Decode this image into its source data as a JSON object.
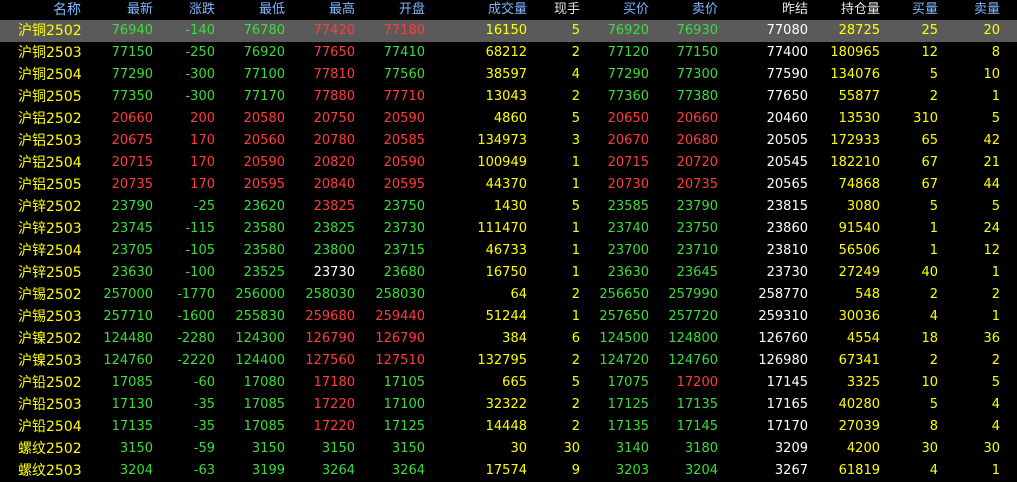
{
  "colors": {
    "up": "#ff3c3c",
    "down": "#3cdc3c",
    "flat": "#ffffff",
    "yellow": "#ffff00",
    "header_blue": "#7fb8ff",
    "selected_bg": "#5a5a5a"
  },
  "headers": {
    "name": "名称",
    "last": "最新",
    "change": "涨跌",
    "low": "最低",
    "high": "最高",
    "open": "开盘",
    "volume": "成交量",
    "current_vol": "现手",
    "bid": "买价",
    "ask": "卖价",
    "prev_settle": "昨结",
    "open_interest": "持仓量",
    "bid_vol": "买量",
    "ask_vol": "卖量"
  },
  "rows": [
    {
      "name": "沪铜2502",
      "last": "76940",
      "change": "-140",
      "low": "76780",
      "high": "77420",
      "open": "77180",
      "volume": "16150",
      "current_vol": "5",
      "bid": "76920",
      "ask": "76930",
      "prev_settle": "77080",
      "open_interest": "28725",
      "bid_vol": "25",
      "ask_vol": "20",
      "c": {
        "last": "down",
        "change": "down",
        "low": "down",
        "high": "up",
        "open": "up",
        "bid": "down",
        "ask": "down"
      }
    },
    {
      "name": "沪铜2503",
      "last": "77150",
      "change": "-250",
      "low": "76920",
      "high": "77650",
      "open": "77410",
      "volume": "68212",
      "current_vol": "2",
      "bid": "77120",
      "ask": "77150",
      "prev_settle": "77400",
      "open_interest": "180965",
      "bid_vol": "12",
      "ask_vol": "8",
      "c": {
        "last": "down",
        "change": "down",
        "low": "down",
        "high": "up",
        "open": "down",
        "bid": "down",
        "ask": "down"
      }
    },
    {
      "name": "沪铜2504",
      "last": "77290",
      "change": "-300",
      "low": "77100",
      "high": "77810",
      "open": "77560",
      "volume": "38597",
      "current_vol": "4",
      "bid": "77290",
      "ask": "77300",
      "prev_settle": "77590",
      "open_interest": "134076",
      "bid_vol": "5",
      "ask_vol": "10",
      "c": {
        "last": "down",
        "change": "down",
        "low": "down",
        "high": "up",
        "open": "down",
        "bid": "down",
        "ask": "down"
      }
    },
    {
      "name": "沪铜2505",
      "last": "77350",
      "change": "-300",
      "low": "77170",
      "high": "77880",
      "open": "77710",
      "volume": "13043",
      "current_vol": "2",
      "bid": "77360",
      "ask": "77380",
      "prev_settle": "77650",
      "open_interest": "55877",
      "bid_vol": "2",
      "ask_vol": "1",
      "c": {
        "last": "down",
        "change": "down",
        "low": "down",
        "high": "up",
        "open": "up",
        "bid": "down",
        "ask": "down"
      }
    },
    {
      "name": "沪铝2502",
      "last": "20660",
      "change": "200",
      "low": "20580",
      "high": "20750",
      "open": "20590",
      "volume": "4860",
      "current_vol": "5",
      "bid": "20650",
      "ask": "20660",
      "prev_settle": "20460",
      "open_interest": "13530",
      "bid_vol": "310",
      "ask_vol": "5",
      "c": {
        "last": "up",
        "change": "up",
        "low": "up",
        "high": "up",
        "open": "up",
        "bid": "up",
        "ask": "up"
      }
    },
    {
      "name": "沪铝2503",
      "last": "20675",
      "change": "170",
      "low": "20560",
      "high": "20780",
      "open": "20585",
      "volume": "134973",
      "current_vol": "3",
      "bid": "20670",
      "ask": "20680",
      "prev_settle": "20505",
      "open_interest": "172933",
      "bid_vol": "65",
      "ask_vol": "42",
      "c": {
        "last": "up",
        "change": "up",
        "low": "up",
        "high": "up",
        "open": "up",
        "bid": "up",
        "ask": "up"
      }
    },
    {
      "name": "沪铝2504",
      "last": "20715",
      "change": "170",
      "low": "20590",
      "high": "20820",
      "open": "20590",
      "volume": "100949",
      "current_vol": "1",
      "bid": "20715",
      "ask": "20720",
      "prev_settle": "20545",
      "open_interest": "182210",
      "bid_vol": "67",
      "ask_vol": "21",
      "c": {
        "last": "up",
        "change": "up",
        "low": "up",
        "high": "up",
        "open": "up",
        "bid": "up",
        "ask": "up"
      }
    },
    {
      "name": "沪铝2505",
      "last": "20735",
      "change": "170",
      "low": "20595",
      "high": "20840",
      "open": "20595",
      "volume": "44370",
      "current_vol": "1",
      "bid": "20730",
      "ask": "20735",
      "prev_settle": "20565",
      "open_interest": "74868",
      "bid_vol": "67",
      "ask_vol": "44",
      "c": {
        "last": "up",
        "change": "up",
        "low": "up",
        "high": "up",
        "open": "up",
        "bid": "up",
        "ask": "up"
      }
    },
    {
      "name": "沪锌2502",
      "last": "23790",
      "change": "-25",
      "low": "23620",
      "high": "23825",
      "open": "23750",
      "volume": "1430",
      "current_vol": "5",
      "bid": "23585",
      "ask": "23790",
      "prev_settle": "23815",
      "open_interest": "3080",
      "bid_vol": "5",
      "ask_vol": "5",
      "c": {
        "last": "down",
        "change": "down",
        "low": "down",
        "high": "up",
        "open": "down",
        "bid": "down",
        "ask": "down"
      }
    },
    {
      "name": "沪锌2503",
      "last": "23745",
      "change": "-115",
      "low": "23580",
      "high": "23825",
      "open": "23730",
      "volume": "111470",
      "current_vol": "1",
      "bid": "23740",
      "ask": "23750",
      "prev_settle": "23860",
      "open_interest": "91540",
      "bid_vol": "1",
      "ask_vol": "24",
      "c": {
        "last": "down",
        "change": "down",
        "low": "down",
        "high": "down",
        "open": "down",
        "bid": "down",
        "ask": "down"
      }
    },
    {
      "name": "沪锌2504",
      "last": "23705",
      "change": "-105",
      "low": "23580",
      "high": "23800",
      "open": "23715",
      "volume": "46733",
      "current_vol": "1",
      "bid": "23700",
      "ask": "23710",
      "prev_settle": "23810",
      "open_interest": "56506",
      "bid_vol": "1",
      "ask_vol": "12",
      "c": {
        "last": "down",
        "change": "down",
        "low": "down",
        "high": "down",
        "open": "down",
        "bid": "down",
        "ask": "down"
      }
    },
    {
      "name": "沪锌2505",
      "last": "23630",
      "change": "-100",
      "low": "23525",
      "high": "23730",
      "open": "23680",
      "volume": "16750",
      "current_vol": "1",
      "bid": "23630",
      "ask": "23645",
      "prev_settle": "23730",
      "open_interest": "27249",
      "bid_vol": "40",
      "ask_vol": "1",
      "c": {
        "last": "down",
        "change": "down",
        "low": "down",
        "high": "flat",
        "open": "down",
        "bid": "down",
        "ask": "down"
      }
    },
    {
      "name": "沪锡2502",
      "last": "257000",
      "change": "-1770",
      "low": "256000",
      "high": "258030",
      "open": "258030",
      "volume": "64",
      "current_vol": "2",
      "bid": "256650",
      "ask": "257990",
      "prev_settle": "258770",
      "open_interest": "548",
      "bid_vol": "2",
      "ask_vol": "2",
      "c": {
        "last": "down",
        "change": "down",
        "low": "down",
        "high": "down",
        "open": "down",
        "bid": "down",
        "ask": "down"
      }
    },
    {
      "name": "沪锡2503",
      "last": "257710",
      "change": "-1600",
      "low": "255830",
      "high": "259680",
      "open": "259440",
      "volume": "51244",
      "current_vol": "1",
      "bid": "257650",
      "ask": "257720",
      "prev_settle": "259310",
      "open_interest": "30036",
      "bid_vol": "4",
      "ask_vol": "1",
      "c": {
        "last": "down",
        "change": "down",
        "low": "down",
        "high": "up",
        "open": "up",
        "bid": "down",
        "ask": "down"
      }
    },
    {
      "name": "沪镍2502",
      "last": "124480",
      "change": "-2280",
      "low": "124300",
      "high": "126790",
      "open": "126790",
      "volume": "384",
      "current_vol": "6",
      "bid": "124500",
      "ask": "124800",
      "prev_settle": "126760",
      "open_interest": "4554",
      "bid_vol": "18",
      "ask_vol": "36",
      "c": {
        "last": "down",
        "change": "down",
        "low": "down",
        "high": "up",
        "open": "up",
        "bid": "down",
        "ask": "down"
      }
    },
    {
      "name": "沪镍2503",
      "last": "124760",
      "change": "-2220",
      "low": "124400",
      "high": "127560",
      "open": "127510",
      "volume": "132795",
      "current_vol": "2",
      "bid": "124720",
      "ask": "124760",
      "prev_settle": "126980",
      "open_interest": "67341",
      "bid_vol": "2",
      "ask_vol": "2",
      "c": {
        "last": "down",
        "change": "down",
        "low": "down",
        "high": "up",
        "open": "up",
        "bid": "down",
        "ask": "down"
      }
    },
    {
      "name": "沪铅2502",
      "last": "17085",
      "change": "-60",
      "low": "17080",
      "high": "17180",
      "open": "17105",
      "volume": "665",
      "current_vol": "5",
      "bid": "17075",
      "ask": "17200",
      "prev_settle": "17145",
      "open_interest": "3325",
      "bid_vol": "10",
      "ask_vol": "5",
      "c": {
        "last": "down",
        "change": "down",
        "low": "down",
        "high": "up",
        "open": "down",
        "bid": "down",
        "ask": "up"
      }
    },
    {
      "name": "沪铅2503",
      "last": "17130",
      "change": "-35",
      "low": "17085",
      "high": "17220",
      "open": "17100",
      "volume": "32322",
      "current_vol": "2",
      "bid": "17125",
      "ask": "17135",
      "prev_settle": "17165",
      "open_interest": "40280",
      "bid_vol": "5",
      "ask_vol": "4",
      "c": {
        "last": "down",
        "change": "down",
        "low": "down",
        "high": "up",
        "open": "down",
        "bid": "down",
        "ask": "down"
      }
    },
    {
      "name": "沪铅2504",
      "last": "17135",
      "change": "-35",
      "low": "17085",
      "high": "17220",
      "open": "17125",
      "volume": "14448",
      "current_vol": "2",
      "bid": "17135",
      "ask": "17145",
      "prev_settle": "17170",
      "open_interest": "27039",
      "bid_vol": "8",
      "ask_vol": "4",
      "c": {
        "last": "down",
        "change": "down",
        "low": "down",
        "high": "up",
        "open": "down",
        "bid": "down",
        "ask": "down"
      }
    },
    {
      "name": "螺纹2502",
      "last": "3150",
      "change": "-59",
      "low": "3150",
      "high": "3150",
      "open": "3150",
      "volume": "30",
      "current_vol": "30",
      "bid": "3140",
      "ask": "3180",
      "prev_settle": "3209",
      "open_interest": "4200",
      "bid_vol": "30",
      "ask_vol": "30",
      "c": {
        "last": "down",
        "change": "down",
        "low": "down",
        "high": "down",
        "open": "down",
        "bid": "down",
        "ask": "down"
      }
    },
    {
      "name": "螺纹2503",
      "last": "3204",
      "change": "-63",
      "low": "3199",
      "high": "3264",
      "open": "3264",
      "volume": "17574",
      "current_vol": "9",
      "bid": "3203",
      "ask": "3204",
      "prev_settle": "3267",
      "open_interest": "61819",
      "bid_vol": "4",
      "ask_vol": "1",
      "c": {
        "last": "down",
        "change": "down",
        "low": "down",
        "high": "down",
        "open": "down",
        "bid": "down",
        "ask": "down"
      }
    }
  ]
}
